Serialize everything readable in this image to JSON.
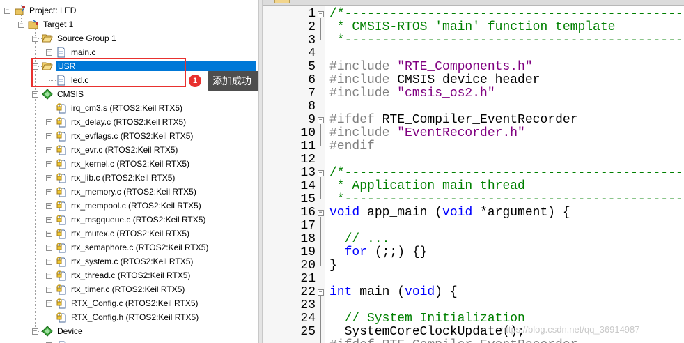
{
  "tree": {
    "project": "Project: LED",
    "target": "Target 1",
    "source_group": "Source Group 1",
    "main_file": "main.c",
    "usr_group": "USR",
    "led_file": "led.c",
    "cmsis_group": "CMSIS",
    "cmsis_files": [
      "irq_cm3.s (RTOS2:Keil RTX5)",
      "rtx_delay.c (RTOS2:Keil RTX5)",
      "rtx_evflags.c (RTOS2:Keil RTX5)",
      "rtx_evr.c (RTOS2:Keil RTX5)",
      "rtx_kernel.c (RTOS2:Keil RTX5)",
      "rtx_lib.c (RTOS2:Keil RTX5)",
      "rtx_memory.c (RTOS2:Keil RTX5)",
      "rtx_mempool.c (RTOS2:Keil RTX5)",
      "rtx_msgqueue.c (RTOS2:Keil RTX5)",
      "rtx_mutex.c (RTOS2:Keil RTX5)",
      "rtx_semaphore.c (RTOS2:Keil RTX5)",
      "rtx_system.c (RTOS2:Keil RTX5)",
      "rtx_thread.c (RTOS2:Keil RTX5)",
      "rtx_timer.c (RTOS2:Keil RTX5)",
      "RTX_Config.c (RTOS2:Keil RTX5)",
      "RTX_Config.h (RTOS2:Keil RTX5)"
    ],
    "device_group": "Device"
  },
  "annotation": {
    "badge": "1",
    "tooltip": "添加成功"
  },
  "editor": {
    "line_numbers": [
      "1",
      "2",
      "3",
      "4",
      "5",
      "6",
      "7",
      "8",
      "9",
      "10",
      "11",
      "12",
      "13",
      "14",
      "15",
      "16",
      "17",
      "18",
      "19",
      "20",
      "21",
      "22",
      "23",
      "24",
      "25"
    ],
    "lines": [
      [
        {
          "t": "/*----------------------------------------------------------------",
          "c": "cm"
        }
      ],
      [
        {
          "t": " * CMSIS-RTOS 'main' function template",
          "c": "cm"
        }
      ],
      [
        {
          "t": " *----------------------------------------------------------------",
          "c": "cm"
        }
      ],
      [
        {
          "t": "",
          "c": ""
        }
      ],
      [
        {
          "t": "#include ",
          "c": "pp"
        },
        {
          "t": "\"RTE_Components.h\"",
          "c": "str"
        }
      ],
      [
        {
          "t": "#include ",
          "c": "pp"
        },
        {
          "t": "CMSIS_device_header",
          "c": ""
        }
      ],
      [
        {
          "t": "#include ",
          "c": "pp"
        },
        {
          "t": "\"cmsis_os2.h\"",
          "c": "str"
        }
      ],
      [
        {
          "t": "",
          "c": ""
        }
      ],
      [
        {
          "t": "#ifdef ",
          "c": "pp"
        },
        {
          "t": "RTE_Compiler_EventRecorder",
          "c": ""
        }
      ],
      [
        {
          "t": "#include ",
          "c": "pp"
        },
        {
          "t": "\"EventRecorder.h\"",
          "c": "str"
        }
      ],
      [
        {
          "t": "#endif",
          "c": "pp"
        }
      ],
      [
        {
          "t": "",
          "c": ""
        }
      ],
      [
        {
          "t": "/*----------------------------------------------------------------",
          "c": "cm"
        }
      ],
      [
        {
          "t": " * Application main thread",
          "c": "cm"
        }
      ],
      [
        {
          "t": " *----------------------------------------------------------------",
          "c": "cm"
        }
      ],
      [
        {
          "t": "void",
          "c": "kw"
        },
        {
          "t": " app_main (",
          "c": ""
        },
        {
          "t": "void",
          "c": "kw"
        },
        {
          "t": " *argument) {",
          "c": ""
        }
      ],
      [
        {
          "t": "",
          "c": ""
        }
      ],
      [
        {
          "t": "  // ...",
          "c": "cm"
        }
      ],
      [
        {
          "t": "  ",
          "c": ""
        },
        {
          "t": "for",
          "c": "kw"
        },
        {
          "t": " (;;) {}",
          "c": ""
        }
      ],
      [
        {
          "t": "}",
          "c": ""
        }
      ],
      [
        {
          "t": "",
          "c": ""
        }
      ],
      [
        {
          "t": "int",
          "c": "kw"
        },
        {
          "t": " main (",
          "c": ""
        },
        {
          "t": "void",
          "c": "kw"
        },
        {
          "t": ") {",
          "c": ""
        }
      ],
      [
        {
          "t": "",
          "c": ""
        }
      ],
      [
        {
          "t": "  // System Initialization",
          "c": "cm"
        }
      ],
      [
        {
          "t": "  SystemCoreClockUpdate();",
          "c": ""
        }
      ],
      [
        {
          "t": "#ifdef RTE_Compiler_EventRecorder",
          "c": "pp"
        }
      ]
    ]
  },
  "watermark": "https://blog.csdn.net/qq_36914987",
  "colors": {
    "selection": "#0078d7",
    "highlight_box": "#e8312f",
    "comment": "#008000",
    "keyword": "#0000ff",
    "string": "#800080"
  }
}
